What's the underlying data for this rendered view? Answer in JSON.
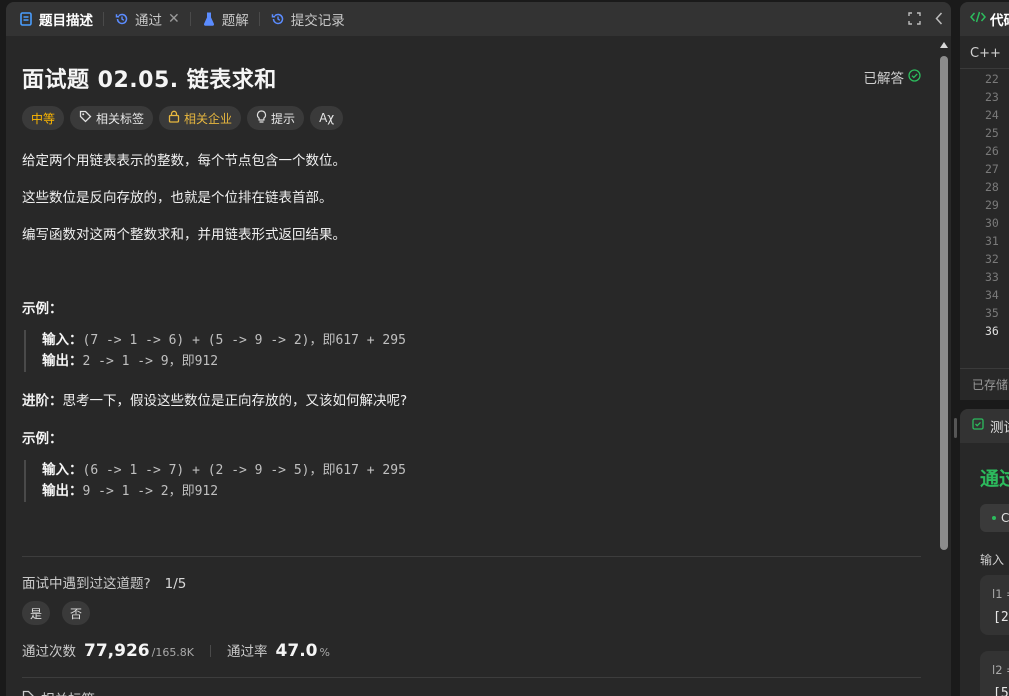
{
  "tabs": {
    "description": "题目描述",
    "passed": "通过",
    "solutions": "题解",
    "submissions": "提交记录"
  },
  "problem": {
    "title": "面试题 02.05. 链表求和",
    "status": "已解答",
    "tags": {
      "difficulty": "中等",
      "topics": "相关标签",
      "companies": "相关企业",
      "hint": "提示",
      "translate": "Aχ"
    },
    "paragraphs": [
      "给定两个用链表表示的整数，每个节点包含一个数位。",
      "这些数位是反向存放的，也就是个位排在链表首部。",
      "编写函数对这两个整数求和，并用链表形式返回结果。"
    ],
    "example_heading_1": "示例：",
    "example_1": {
      "input_label": "输入：",
      "input_value": "(7 -> 1 -> 6) + (5 -> 9 -> 2)，即617 + 295",
      "output_label": "输出：",
      "output_value": "2 -> 1 -> 9，即912"
    },
    "followup_label": "进阶：",
    "followup_text": "思考一下，假设这些数位是正向存放的，又该如何解决呢?",
    "example_heading_2": "示例：",
    "example_2": {
      "input_label": "输入：",
      "input_value": "(6 -> 1 -> 7) + (2 -> 9 -> 5)，即617 + 295",
      "output_label": "输出：",
      "output_value": "9 -> 1 -> 2，即912"
    },
    "interview_question": "面试中遇到过这道题?",
    "interview_ratio": "1/5",
    "yes": "是",
    "no": "否",
    "accepted_label": "通过次数",
    "accepted_value": "77,926",
    "submissions_value": "/165.8K",
    "rate_label": "通过率",
    "rate_value": "47.0",
    "rate_unit": "%",
    "related_label": "相关标签"
  },
  "code_panel": {
    "title": "代码",
    "language": "C++",
    "line_numbers": [
      "22",
      "23",
      "24",
      "25",
      "26",
      "27",
      "28",
      "29",
      "30",
      "31",
      "32",
      "33",
      "34",
      "35",
      "36"
    ],
    "current_line": "36",
    "saved": "已存储"
  },
  "test_panel": {
    "title": "测试",
    "result": "通过",
    "case_label": "C",
    "input_label": "输入",
    "param1_name": "l1 =",
    "param1_value": "[2",
    "param2_name": "l2 =",
    "param2_value": "[5"
  },
  "colors": {
    "accent_green": "#2cbb5d",
    "difficulty_medium": "#ffb800",
    "tab_description_icon": "#4a9eff",
    "tab_solutions_icon": "#5b8cff",
    "code_icon": "#2cbb5d"
  }
}
